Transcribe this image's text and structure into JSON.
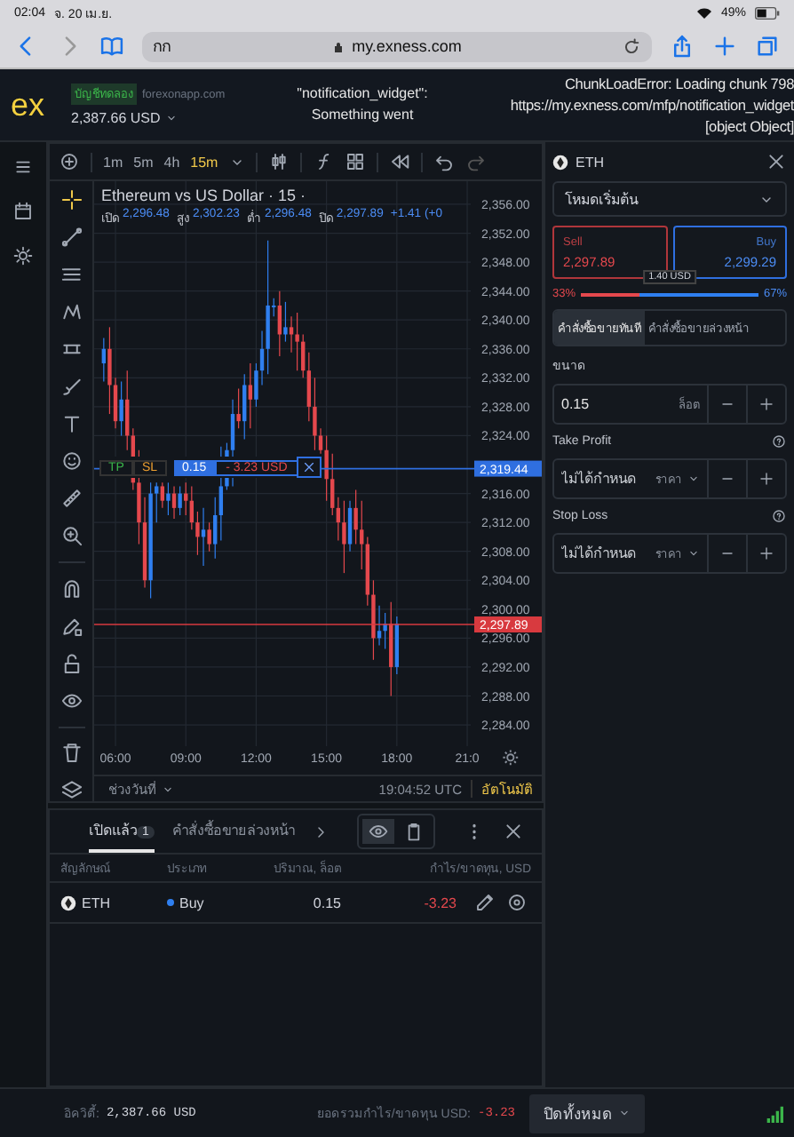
{
  "status_bar": {
    "time": "02:04",
    "date": "จ. 20 เม.ย.",
    "battery": "49%"
  },
  "browser": {
    "reader": "กก",
    "url": "my.exness.com"
  },
  "header": {
    "logo": "ex",
    "account_badge": "บัญชีทดลอง",
    "server": "forexonapp.com",
    "balance": "2,387.66 USD",
    "widget_error": [
      "\"notification_widget\":",
      "Something went"
    ],
    "chunk_error": [
      "ChunkLoadError: Loading chunk 798",
      "https://my.exness.com/mfp/notification_widget",
      "[object Object]"
    ]
  },
  "chart_toolbar": {
    "timeframes": [
      {
        "label": "1m",
        "selected": false
      },
      {
        "label": "5m",
        "selected": false
      },
      {
        "label": "4h",
        "selected": false
      },
      {
        "label": "15m",
        "selected": true
      }
    ]
  },
  "drawing_tools": [
    {
      "selected": true
    },
    {
      "selected": false
    },
    {
      "selected": false
    },
    {
      "selected": false
    },
    {
      "selected": false
    },
    {
      "selected": false
    },
    {
      "selected": false
    },
    {
      "selected": false
    },
    {
      "selected": false
    },
    {
      "selected": false
    },
    {
      "selected": false
    },
    {
      "selected": false
    },
    {
      "selected": false
    },
    {
      "selected": false
    },
    {
      "selected": false
    },
    {
      "selected": false
    }
  ],
  "chart": {
    "title": "Ethereum vs US Dollar · 15 ·",
    "legend": [
      {
        "label": "เปิด",
        "value": "2,296.48"
      },
      {
        "label": "สูง",
        "value": "2,302.23"
      },
      {
        "label": "ต่ำ",
        "value": "2,296.48"
      },
      {
        "label": "ปิด",
        "value": "2,297.89"
      }
    ],
    "change": "+1.41 (+0",
    "chart_data": {
      "type": "candlestick",
      "x": [
        5.5,
        5.75,
        6,
        6.25,
        6.5,
        6.75,
        7,
        7.25,
        7.5,
        7.75,
        8,
        8.25,
        8.5,
        8.75,
        9,
        9.25,
        9.5,
        9.75,
        10,
        10.25,
        10.5,
        10.75,
        11,
        11.25,
        11.5,
        11.75,
        12,
        12.25,
        12.5,
        12.75,
        13,
        13.25,
        13.5,
        13.75,
        14,
        14.25,
        14.5,
        14.75,
        15,
        15.25,
        15.5,
        15.75,
        16,
        16.25,
        16.5,
        16.75,
        17,
        17.25,
        17.5,
        17.75,
        18
      ],
      "ohlc": [
        [
          2334,
          2337.5,
          2331.5,
          2336
        ],
        [
          2336,
          2339,
          2327,
          2331
        ],
        [
          2331,
          2332,
          2325,
          2326
        ],
        [
          2326,
          2331.5,
          2324,
          2329
        ],
        [
          2329,
          2333,
          2322,
          2324
        ],
        [
          2324,
          2325,
          2316.5,
          2317.5
        ],
        [
          2317.5,
          2322,
          2309,
          2312
        ],
        [
          2312,
          2315.5,
          2303,
          2304
        ],
        [
          2304,
          2317.5,
          2301.5,
          2316
        ],
        [
          2316,
          2317.5,
          2312,
          2317
        ],
        [
          2317,
          2317.5,
          2314,
          2315
        ],
        [
          2315,
          2317.5,
          2313,
          2316
        ],
        [
          2316,
          2317,
          2312.5,
          2314
        ],
        [
          2314,
          2317,
          2313,
          2316
        ],
        [
          2316,
          2317.5,
          2313,
          2315
        ],
        [
          2315,
          2317,
          2311,
          2312
        ],
        [
          2312,
          2313.5,
          2307.5,
          2310
        ],
        [
          2310,
          2314,
          2306,
          2311
        ],
        [
          2311,
          2312,
          2308,
          2309
        ],
        [
          2309,
          2315.5,
          2307,
          2313
        ],
        [
          2313,
          2322.5,
          2309.5,
          2317
        ],
        [
          2317,
          2323,
          2316.5,
          2322
        ],
        [
          2322,
          2329,
          2317,
          2327
        ],
        [
          2327,
          2330.5,
          2325,
          2326
        ],
        [
          2326,
          2332.5,
          2323.5,
          2331
        ],
        [
          2331,
          2334,
          2325,
          2329
        ],
        [
          2329,
          2334,
          2328,
          2333
        ],
        [
          2333,
          2338.5,
          2331,
          2336
        ],
        [
          2336,
          2351,
          2332.5,
          2342
        ],
        [
          2342,
          2343,
          2340.5,
          2342
        ],
        [
          2342,
          2344,
          2335,
          2338
        ],
        [
          2338,
          2342.5,
          2337,
          2339
        ],
        [
          2339,
          2340.5,
          2335.5,
          2338
        ],
        [
          2338,
          2341,
          2333,
          2337
        ],
        [
          2337,
          2338,
          2332,
          2333
        ],
        [
          2333,
          2335.5,
          2326,
          2328
        ],
        [
          2328,
          2332,
          2322,
          2324
        ],
        [
          2324,
          2325,
          2321.5,
          2322
        ],
        [
          2322,
          2324,
          2315,
          2318
        ],
        [
          2318,
          2321.5,
          2313,
          2314
        ],
        [
          2314,
          2315.5,
          2309.5,
          2312
        ],
        [
          2312,
          2315,
          2305,
          2309
        ],
        [
          2309,
          2315,
          2308,
          2314
        ],
        [
          2314,
          2316.5,
          2309,
          2311
        ],
        [
          2311,
          2315,
          2305.5,
          2309
        ],
        [
          2309,
          2310,
          2300.5,
          2302
        ],
        [
          2302,
          2304,
          2293,
          2296
        ],
        [
          2296,
          2300.5,
          2295,
          2297
        ],
        [
          2297,
          2299.5,
          2294.5,
          2298
        ],
        [
          2298,
          2301,
          2288,
          2292
        ],
        [
          2292,
          2299,
          2291,
          2298
        ]
      ],
      "xlim": [
        5.09,
        21.15
      ],
      "ylim": [
        2281.06,
        2359.19
      ],
      "grid": true,
      "ref_lines": [
        {
          "axis": "y",
          "value": 2319.44,
          "label": "2,319.44",
          "color": "#2f6fe0"
        },
        {
          "axis": "y",
          "value": 2297.89,
          "label": "2,297.89",
          "color": "#d83a3f"
        }
      ],
      "yticks": [
        {
          "value": 2356,
          "label": "2,356.00"
        },
        {
          "value": 2352,
          "label": "2,352.00"
        },
        {
          "value": 2348,
          "label": "2,348.00"
        },
        {
          "value": 2344,
          "label": "2,344.00"
        },
        {
          "value": 2340,
          "label": "2,340.00"
        },
        {
          "value": 2336,
          "label": "2,336.00"
        },
        {
          "value": 2332,
          "label": "2,332.00"
        },
        {
          "value": 2328,
          "label": "2,328.00"
        },
        {
          "value": 2324,
          "label": "2,324.00"
        },
        {
          "value": 2316,
          "label": "2,316.00"
        },
        {
          "value": 2312,
          "label": "2,312.00"
        },
        {
          "value": 2308,
          "label": "2,308.00"
        },
        {
          "value": 2304,
          "label": "2,304.00"
        },
        {
          "value": 2300,
          "label": "2,300.00"
        },
        {
          "value": 2296,
          "label": "2,296.00"
        },
        {
          "value": 2292,
          "label": "2,292.00"
        },
        {
          "value": 2288,
          "label": "2,288.00"
        },
        {
          "value": 2284,
          "label": "2,284.00"
        }
      ],
      "xticks": [
        {
          "value": 6,
          "label": "06:00"
        },
        {
          "value": 9,
          "label": "09:00"
        },
        {
          "value": 12,
          "label": "12:00"
        },
        {
          "value": 15,
          "label": "15:00"
        },
        {
          "value": 18,
          "label": "18:00"
        },
        {
          "value": 21,
          "label": "21:0"
        }
      ]
    },
    "order_bar": {
      "tp": "TP",
      "sl": "SL",
      "volume": "0.15",
      "pnl": "- 3.23 USD"
    },
    "date_range": "ช่วงวันที่",
    "clock": "19:04:52 UTC",
    "auto": "อัตโนมัติ"
  },
  "trade_panel": {
    "symbol": "ETH",
    "mode": "โหมดเริ่มต้น",
    "sell": {
      "label": "Sell",
      "price": "2,297.89"
    },
    "buy": {
      "label": "Buy",
      "price": "2,299.29"
    },
    "spread": "1.40 USD",
    "sentiment": {
      "sell": "33%",
      "buy": "67%",
      "level": 0.33
    },
    "order_tabs": [
      {
        "label": "คำสั่งซื้อขายทันที",
        "selected": true
      },
      {
        "label": "คำสั่งซื้อขายล่วงหน้า",
        "selected": false
      }
    ],
    "volume": {
      "label": "ขนาด",
      "value": "0.15",
      "unit": "ล็อต"
    },
    "take_profit": {
      "label": "Take Profit",
      "placeholder": "ไม่ได้กำหนด",
      "mode": "ราคา"
    },
    "stop_loss": {
      "label": "Stop Loss",
      "placeholder": "ไม่ได้กำหนด",
      "mode": "ราคา"
    }
  },
  "positions": {
    "tabs": [
      {
        "label": "เปิดแล้ว",
        "count": "1",
        "selected": true
      },
      {
        "label": "คำสั่งซื้อขายล่วงหน้า",
        "selected": false
      }
    ],
    "view_toggle": [
      {
        "selected": true
      },
      {
        "selected": false
      }
    ],
    "columns": [
      "สัญลักษณ์",
      "ประเภท",
      "ปริมาณ, ล็อต",
      "กำไร/ขาดทุน, USD"
    ],
    "rows": [
      {
        "symbol": "ETH",
        "side": "Buy",
        "kind": "buy",
        "volume": "0.15",
        "pnl": "-3.23"
      }
    ]
  },
  "footer": {
    "equity_label": "อิควิตี้:",
    "equity": "2,387.66 USD",
    "pnl_label": "ยอดรวมกำไร/ขาดทุน USD:",
    "pnl": "-3.23",
    "close_all": "ปิดทั้งหมด"
  }
}
